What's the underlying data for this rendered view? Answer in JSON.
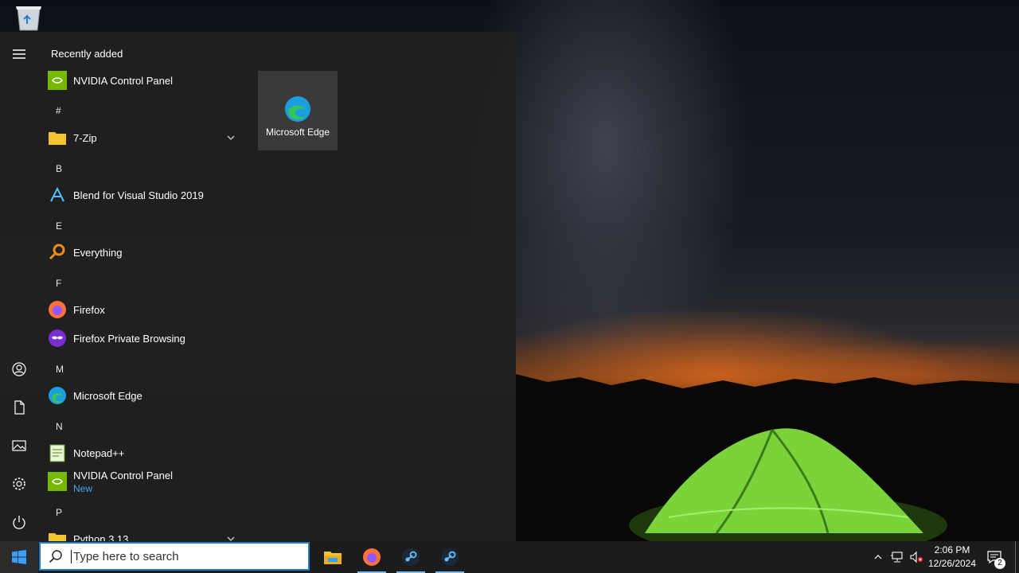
{
  "start_menu": {
    "header": "Recently added",
    "rail": [
      "hamburger-icon",
      "user-icon",
      "documents-icon",
      "pictures-icon",
      "settings-icon",
      "power-icon"
    ],
    "apps": [
      {
        "label": "NVIDIA Control Panel"
      },
      {
        "letter": "#"
      },
      {
        "label": "7-Zip"
      },
      {
        "letter": "B"
      },
      {
        "label": "Blend for Visual Studio 2019"
      },
      {
        "letter": "E"
      },
      {
        "label": "Everything"
      },
      {
        "letter": "F"
      },
      {
        "label": "Firefox"
      },
      {
        "label": "Firefox Private Browsing"
      },
      {
        "letter": "M"
      },
      {
        "label": "Microsoft Edge"
      },
      {
        "letter": "N"
      },
      {
        "label": "Notepad++"
      },
      {
        "label": "NVIDIA Control Panel",
        "sub": "New"
      },
      {
        "letter": "P"
      },
      {
        "label": "Python 3.13"
      }
    ],
    "tile": {
      "label": "Microsoft Edge",
      "icon": "edge-icon"
    }
  },
  "taskbar": {
    "search_placeholder": "Type here to search",
    "pinned": [
      "file-explorer-icon",
      "firefox-icon",
      "steam-icon",
      "steam-icon"
    ],
    "clock": {
      "time": "2:06 PM",
      "date": "12/26/2024"
    },
    "notifications": "2"
  },
  "colors": {
    "accent": "#1a7fd4",
    "menu_bg": "#202020",
    "taskbar_bg": "#1c1c1c",
    "new_badge": "#4ea2f0"
  }
}
